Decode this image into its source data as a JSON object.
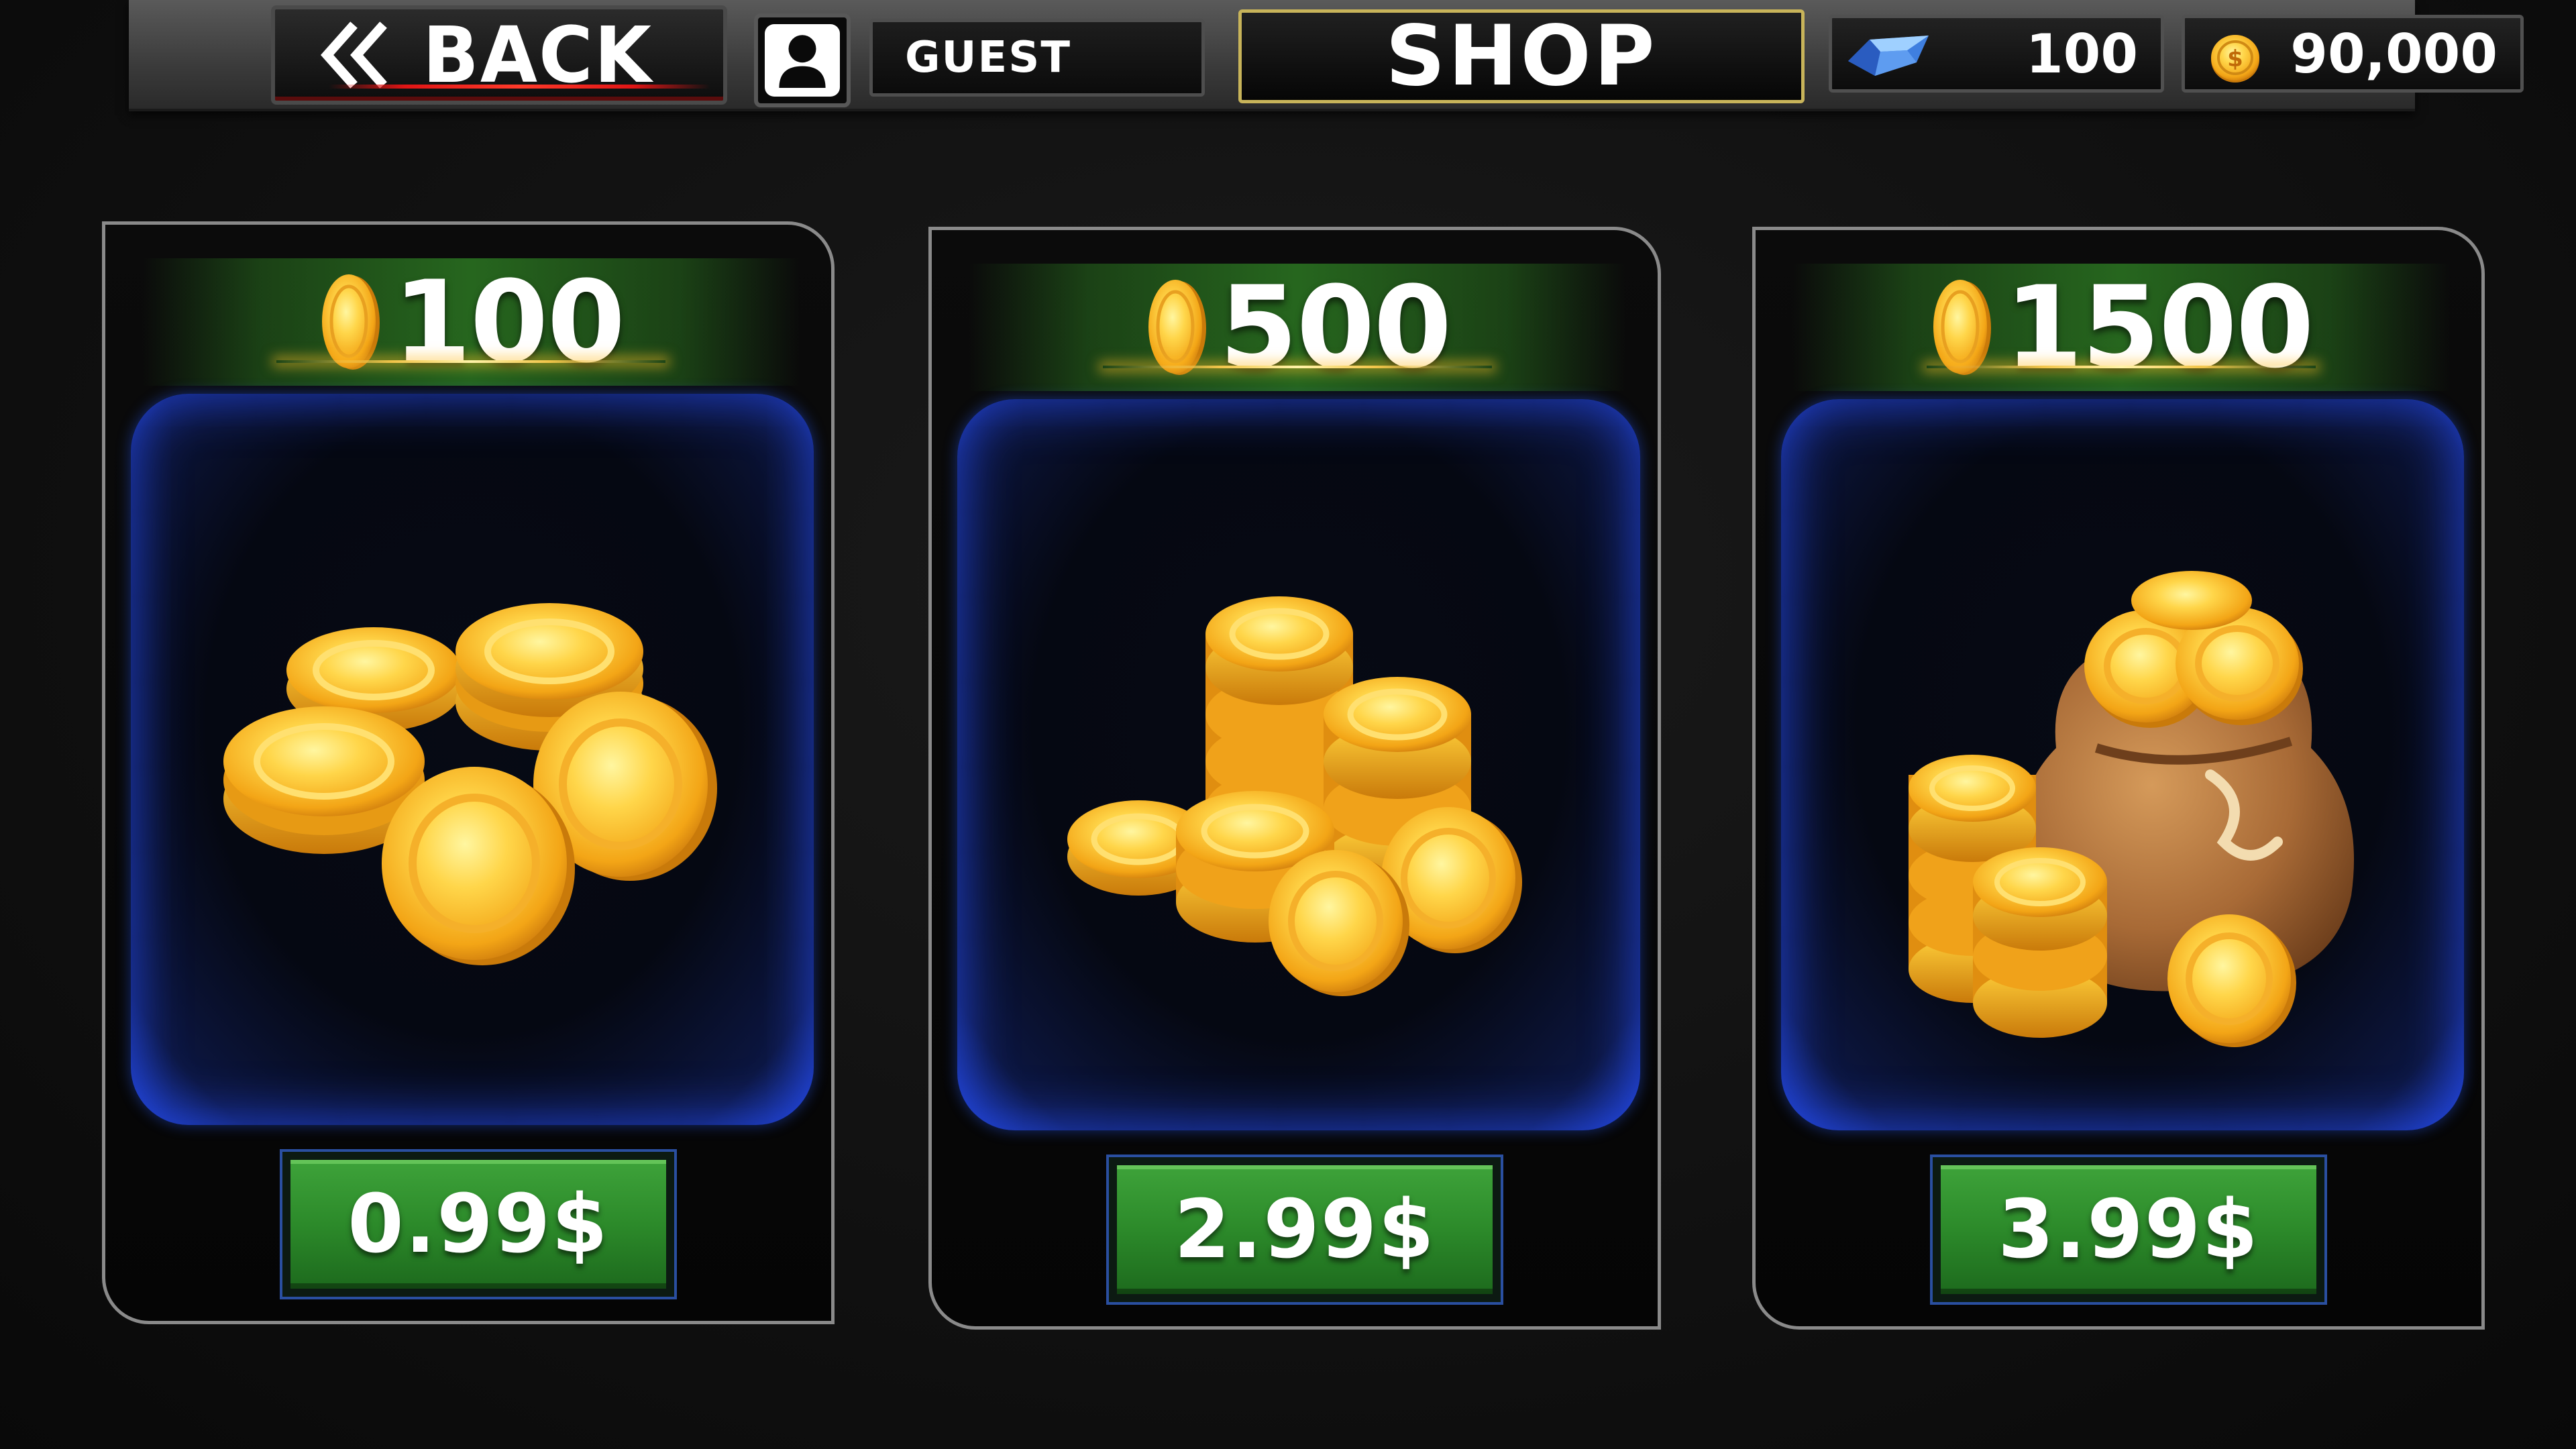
{
  "header": {
    "back_label": "BACK",
    "user_name": "GUEST",
    "title": "SHOP",
    "gems": "100",
    "coins": "90,000"
  },
  "colors": {
    "accent_gold": "#f2c54a",
    "button_green": "#2c8a2a",
    "panel_blue": "#1b38b0",
    "back_red": "#e01515"
  },
  "offers": [
    {
      "amount": "100",
      "price": "0.99$",
      "art": "coin-pile-icon"
    },
    {
      "amount": "500",
      "price": "2.99$",
      "art": "coin-stacks-icon"
    },
    {
      "amount": "1500",
      "price": "3.99$",
      "art": "coin-sack-icon"
    }
  ]
}
